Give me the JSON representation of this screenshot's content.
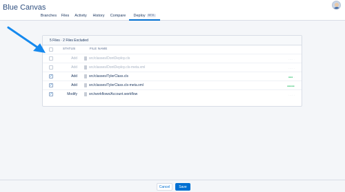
{
  "app": {
    "title": "Blue Canvas"
  },
  "tabs": [
    {
      "label": "Branches",
      "active": false
    },
    {
      "label": "Files",
      "active": false
    },
    {
      "label": "Activity",
      "active": false
    },
    {
      "label": "History",
      "active": false
    },
    {
      "label": "Compare",
      "active": false
    },
    {
      "label": "Deploy",
      "badge": "BETA",
      "active": true
    }
  ],
  "deploy": {
    "summary": "5 Files · 2 Files Excluded",
    "columns": {
      "status": "STATUS",
      "file_name": "FILE NAME"
    },
    "rows": [
      {
        "checked": false,
        "status": "Add",
        "file": "src/classes/DontDeploy.cls",
        "diff": "- - - ·",
        "included": false
      },
      {
        "checked": false,
        "status": "Add",
        "file": "src/classes/DontDeploy.cls-meta.xml",
        "diff": "- - - -",
        "included": false
      },
      {
        "checked": true,
        "status": "Add",
        "file": "src/classes/TylerClass.cls",
        "diff": "■■■ ·",
        "included": true,
        "diff_color": "#4bca81"
      },
      {
        "checked": true,
        "status": "Add",
        "file": "src/classes/TylerClass.cls-meta.xml",
        "diff": "■■■■■",
        "included": true,
        "diff_color": "#4bca81"
      },
      {
        "checked": true,
        "status": "Modify",
        "file": "src/workflows/Account.workflow",
        "diff": "- - - -",
        "included": true
      }
    ]
  },
  "footer": {
    "cancel_label": "Cancel",
    "save_label": "Save"
  },
  "colors": {
    "accent": "#0070d2",
    "arrow": "#1589ee",
    "added": "#4bca81"
  }
}
